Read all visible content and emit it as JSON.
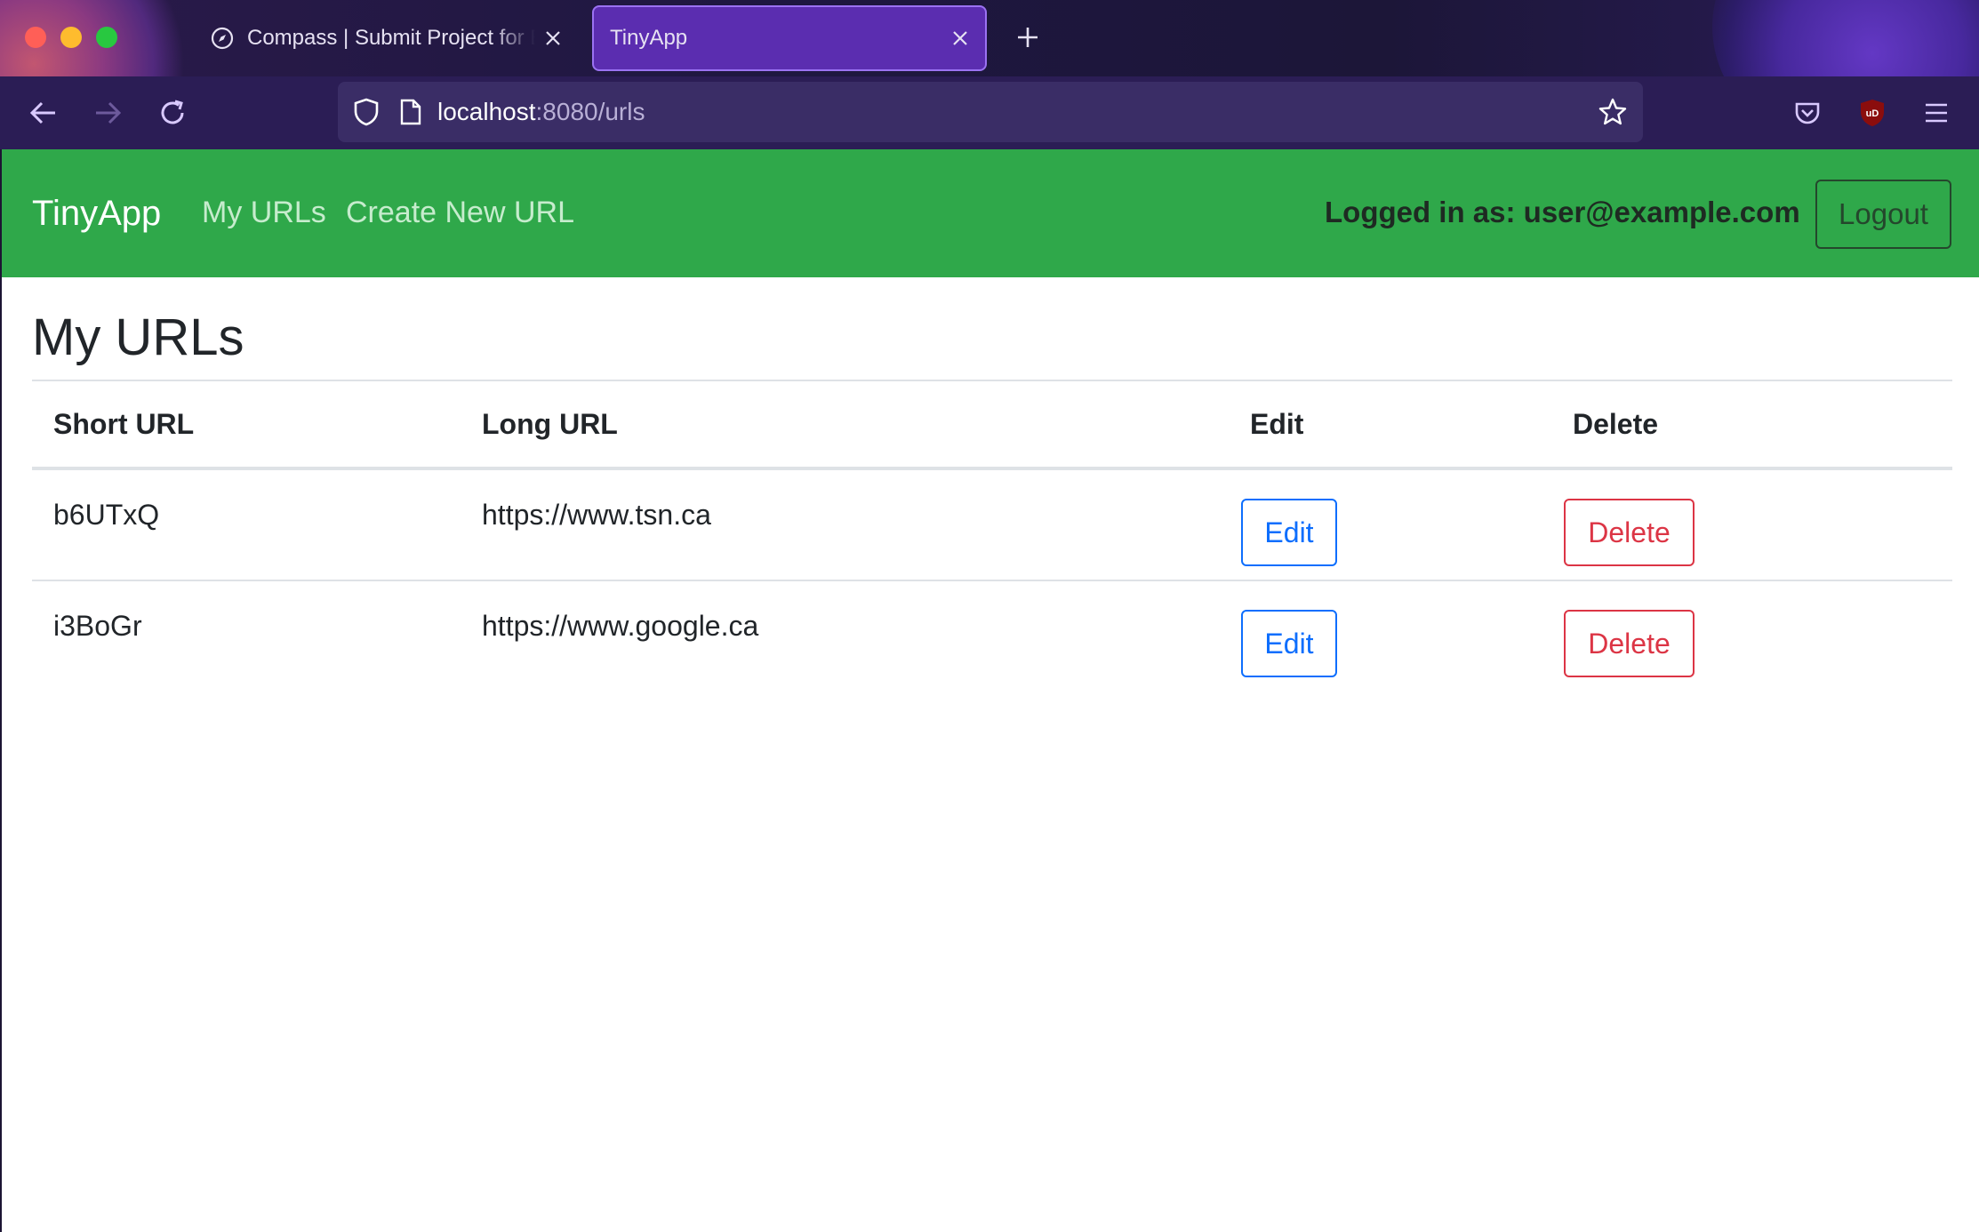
{
  "browser": {
    "tabs": [
      {
        "title": "Compass | Submit Project for Evaluation",
        "active": false,
        "favicon": "compass-icon"
      },
      {
        "title": "TinyApp",
        "active": true,
        "favicon": ""
      }
    ],
    "new_tab_icon": "plus-icon",
    "url_host": "localhost",
    "url_rest": ":8080/urls",
    "icons": [
      "back-arrow-icon",
      "forward-arrow-icon",
      "reload-icon",
      "shield-icon",
      "page-icon",
      "star-icon",
      "pocket-icon",
      "ublock-icon",
      "hamburger-menu-icon"
    ]
  },
  "site": {
    "brand": "TinyApp",
    "nav": {
      "my_urls": "My URLs",
      "create_new": "Create New URL"
    },
    "logged_in": "Logged in as: user@example.com",
    "logout_label": "Logout",
    "accent_color": "#2fa84a"
  },
  "main": {
    "title": "My URLs",
    "table": {
      "headers": [
        "Short URL",
        "Long URL",
        "Edit",
        "Delete"
      ],
      "rows": [
        {
          "short": "b6UTxQ",
          "long": "https://www.tsn.ca",
          "edit_label": "Edit",
          "delete_label": "Delete"
        },
        {
          "short": "i3BoGr",
          "long": "https://www.google.ca",
          "edit_label": "Edit",
          "delete_label": "Delete"
        }
      ]
    }
  }
}
